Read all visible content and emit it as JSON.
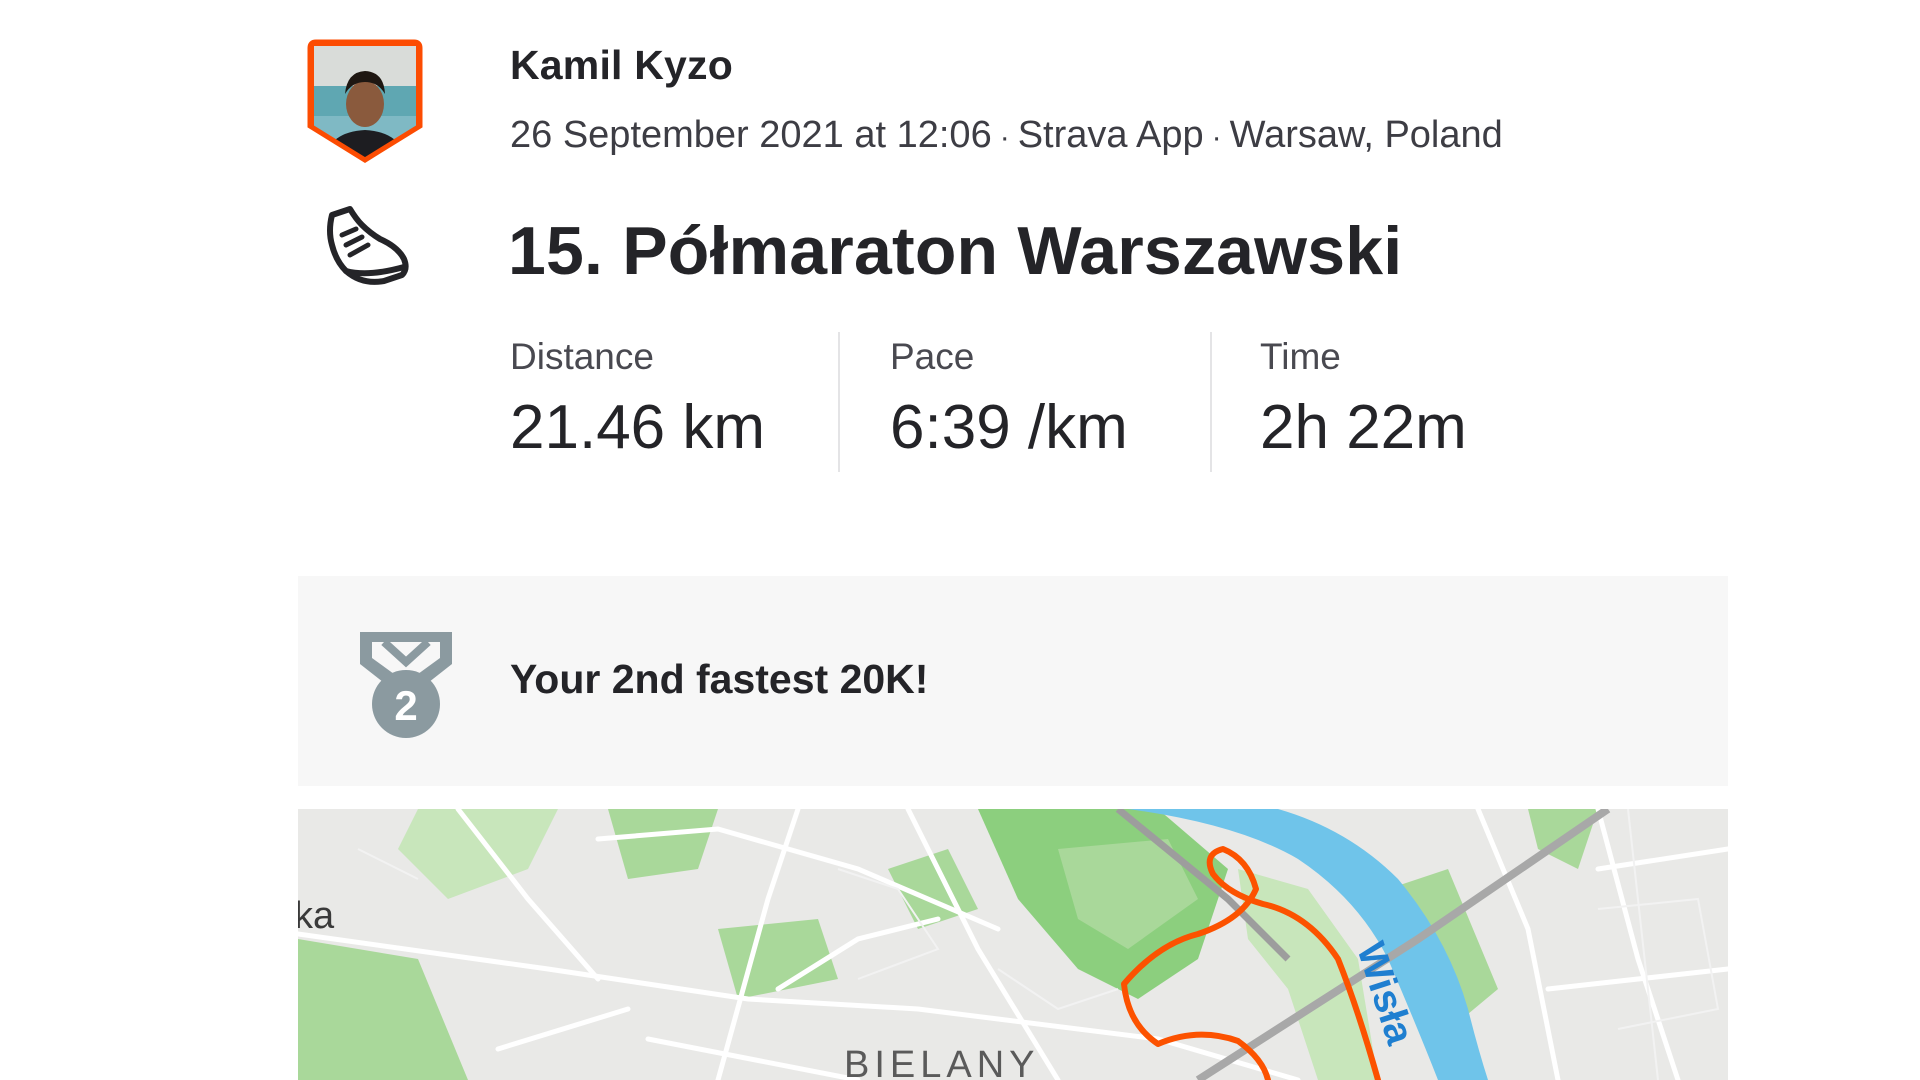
{
  "athlete": {
    "name": "Kamil Kyzo",
    "avatar_icon": "athlete-avatar-shield",
    "avatar_border_color": "#fc4c02"
  },
  "activity": {
    "date_time": "26 September 2021 at 12:06",
    "device": "Strava App",
    "location": "Warsaw, Poland",
    "separator": "·",
    "type_icon": "running-shoe-icon",
    "title": "15. Półmaraton Warszawski"
  },
  "stats": {
    "distance": {
      "label": "Distance",
      "value": "21.46 km"
    },
    "pace": {
      "label": "Pace",
      "value": "6:39 /km"
    },
    "time": {
      "label": "Time",
      "value": "2h 22m"
    }
  },
  "achievement": {
    "icon": "medal-2-icon",
    "rank_number": "2",
    "text": "Your 2nd fastest 20K!",
    "medal_color": "#8b9aa0"
  },
  "map": {
    "labels": {
      "left_partial": "ka",
      "district": "BIELANY",
      "river": "Wisła"
    },
    "route_color": "#fc5200",
    "water_color": "#6fc4ea",
    "park_color": "#a9d89a"
  }
}
